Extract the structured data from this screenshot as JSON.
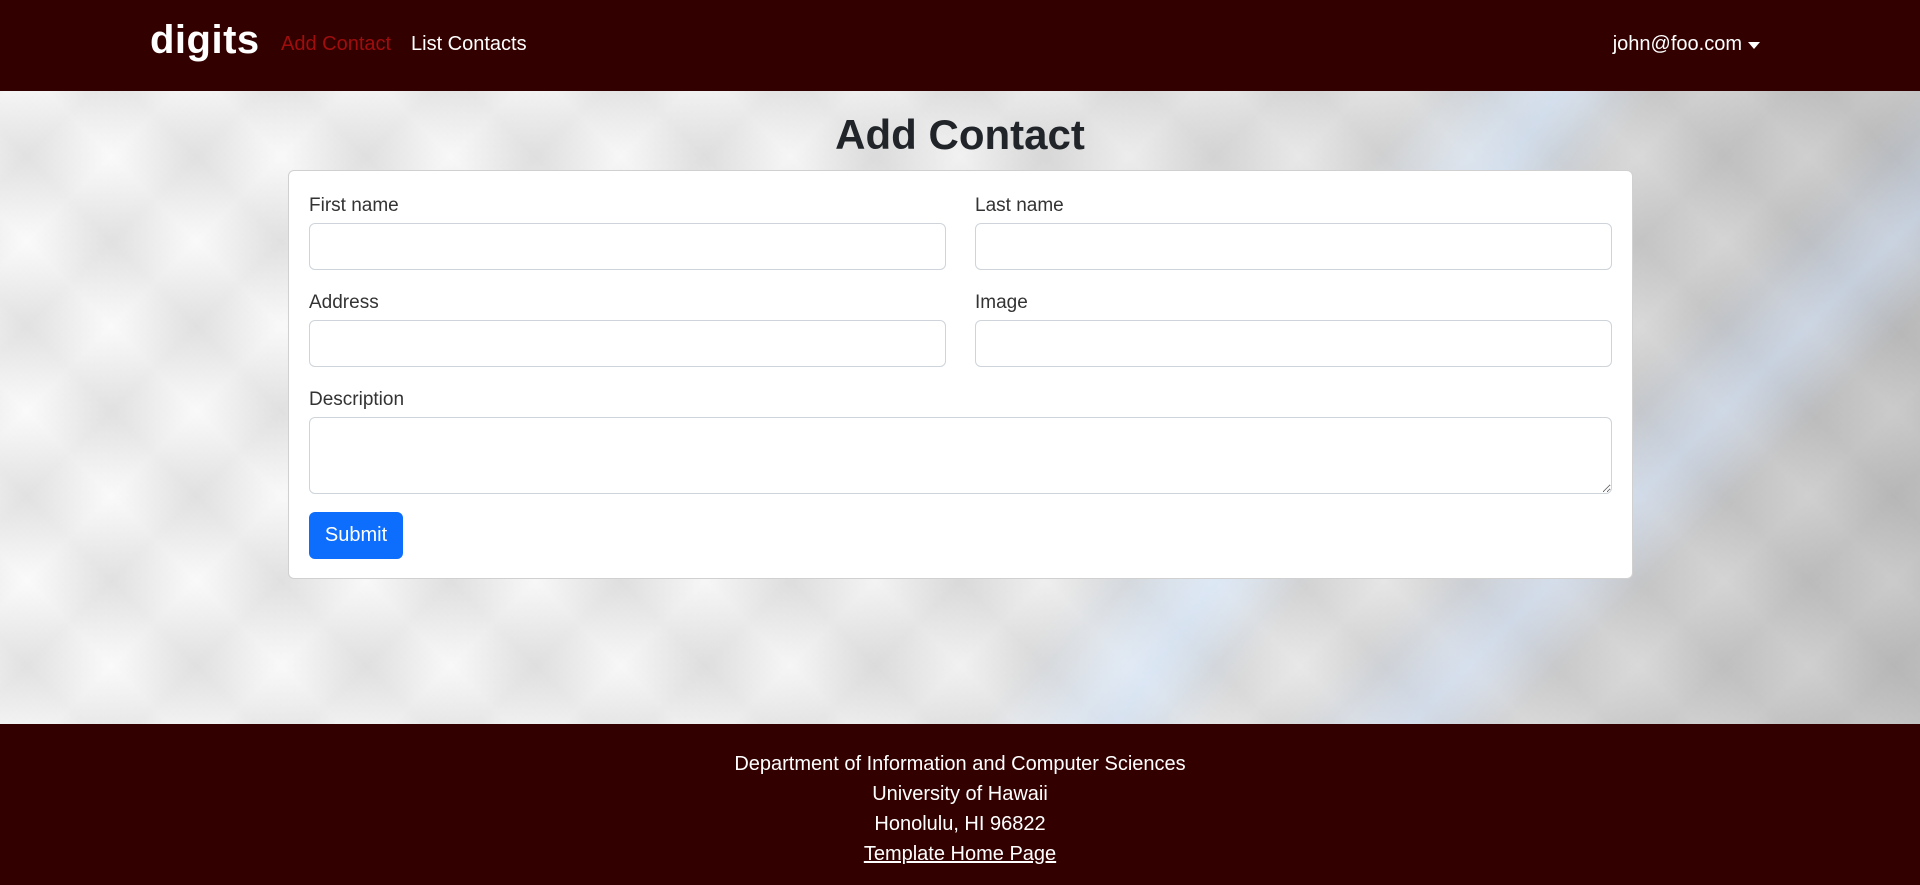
{
  "colors": {
    "brand": "#330000",
    "active_link": "#a00d0d",
    "primary_button": "#0d6efd"
  },
  "navbar": {
    "brand": "digits",
    "links": [
      {
        "label": "Add Contact",
        "active": true
      },
      {
        "label": "List Contacts",
        "active": false
      }
    ],
    "user": {
      "email": "john@foo.com",
      "icon": "caret-down-icon"
    }
  },
  "main": {
    "title": "Add Contact",
    "form": {
      "first_name": {
        "label": "First name",
        "value": ""
      },
      "last_name": {
        "label": "Last name",
        "value": ""
      },
      "address": {
        "label": "Address",
        "value": ""
      },
      "image": {
        "label": "Image",
        "value": ""
      },
      "description": {
        "label": "Description",
        "value": ""
      },
      "submit_label": "Submit"
    }
  },
  "footer": {
    "lines": [
      "Department of Information and Computer Sciences",
      "University of Hawaii",
      "Honolulu, HI 96822"
    ],
    "link": "Template Home Page"
  }
}
